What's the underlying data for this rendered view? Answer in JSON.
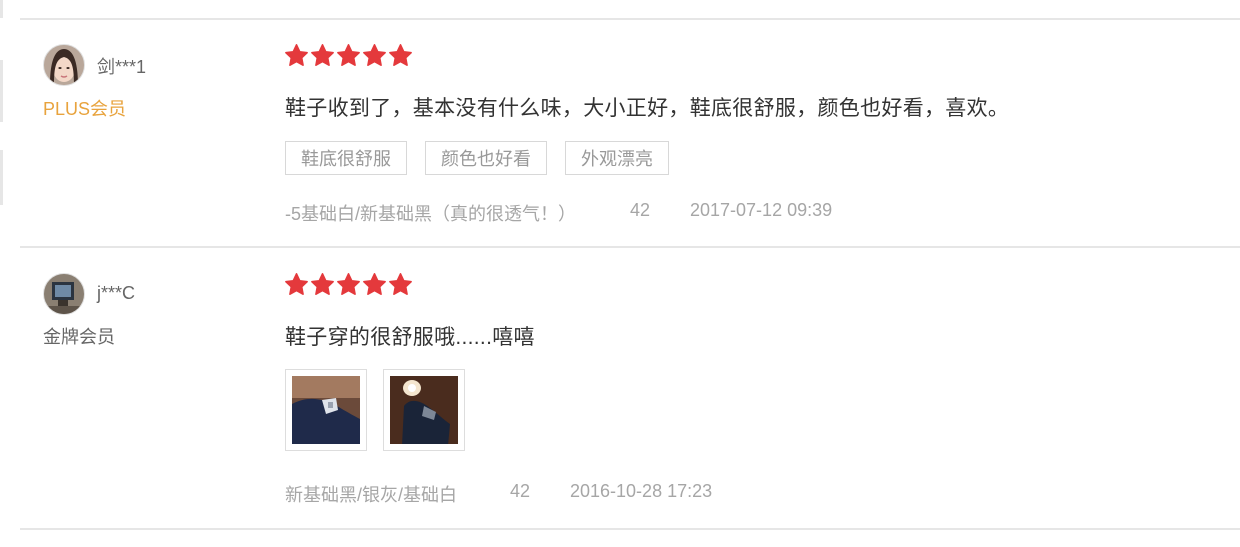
{
  "reviews": [
    {
      "username": "剑***1",
      "membership": "PLUS会员",
      "membership_color": "#e8a33d",
      "rating": 5,
      "content": "鞋子收到了，基本没有什么味，大小正好，鞋底很舒服，颜色也好看，喜欢。",
      "tags": [
        "鞋底很舒服",
        "颜色也好看",
        "外观漂亮"
      ],
      "variant": "-5基础白/新基础黑（真的很透气！）",
      "size": "42",
      "timestamp": "2017-07-12 09:39"
    },
    {
      "username": "j***C",
      "membership": "金牌会员",
      "membership_color": "#666666",
      "rating": 5,
      "content": "鞋子穿的很舒服哦......嘻嘻",
      "images": [
        "shoe-photo",
        "shoe-photo"
      ],
      "variant": "新基础黑/银灰/基础白",
      "size": "42",
      "timestamp": "2016-10-28 17:23"
    }
  ],
  "star_color": "#e4393c"
}
